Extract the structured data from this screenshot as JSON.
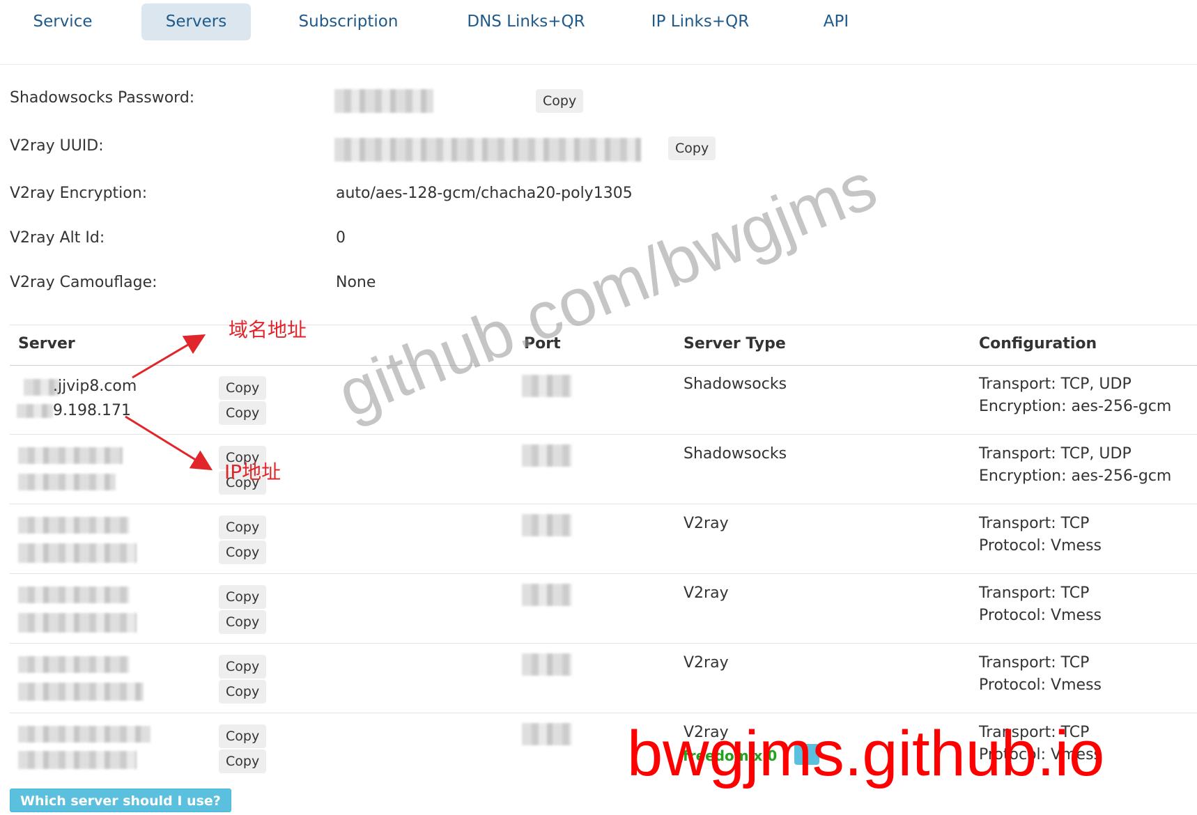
{
  "tabs": [
    {
      "label": "Service"
    },
    {
      "label": "Servers"
    },
    {
      "label": "Subscription"
    },
    {
      "label": "DNS Links+QR"
    },
    {
      "label": "IP Links+QR"
    },
    {
      "label": "API"
    }
  ],
  "info": {
    "ss_password_label": "Shadowsocks Password:",
    "uuid_label": "V2ray UUID:",
    "encryption_label": "V2ray Encryption:",
    "encryption_value": "auto/aes-128-gcm/chacha20-poly1305",
    "alt_id_label": "V2ray Alt Id:",
    "alt_id_value": "0",
    "camouflage_label": "V2ray Camouflage:",
    "camouflage_value": "None",
    "copy_label": "Copy"
  },
  "table": {
    "headers": {
      "server": "Server",
      "port": "Port",
      "type": "Server Type",
      "config": "Configuration"
    },
    "rows": [
      {
        "host1": ".jjvip8.com",
        "host2": "9.198.171",
        "type": "Shadowsocks",
        "config1": "Transport: TCP, UDP",
        "config2": "Encryption: aes-256-gcm"
      },
      {
        "host1": "",
        "host2": "",
        "type": "Shadowsocks",
        "config1": "Transport: TCP, UDP",
        "config2": "Encryption: aes-256-gcm"
      },
      {
        "host1": "",
        "host2": "",
        "type": "V2ray",
        "config1": "Transport: TCP",
        "config2": "Protocol: Vmess"
      },
      {
        "host1": "",
        "host2": "",
        "type": "V2ray",
        "config1": "Transport: TCP",
        "config2": "Protocol: Vmess"
      },
      {
        "host1": "",
        "host2": "",
        "type": "V2ray",
        "config1": "Transport: TCP",
        "config2": "Protocol: Vmess"
      },
      {
        "host1": "",
        "host2": "",
        "type": "V2ray",
        "config1": "Transport: TCP",
        "config2": "Protocol: Vmess"
      }
    ],
    "copy_label": "Copy"
  },
  "which_button": "Which server should I use?",
  "annotations": {
    "domain": "域名地址",
    "ip": "IP地址"
  },
  "watermark": "github.com/bwgjms",
  "brand_overlay": "bwgjms.github.io",
  "partial_green_text": "freedom x 0",
  "colors": {
    "tab_text": "#1f5a8a",
    "tab_active_bg": "#dbe6ee",
    "annotation": "#e0262b",
    "brand": "#ff0000",
    "info_button": "#5bc0de"
  }
}
